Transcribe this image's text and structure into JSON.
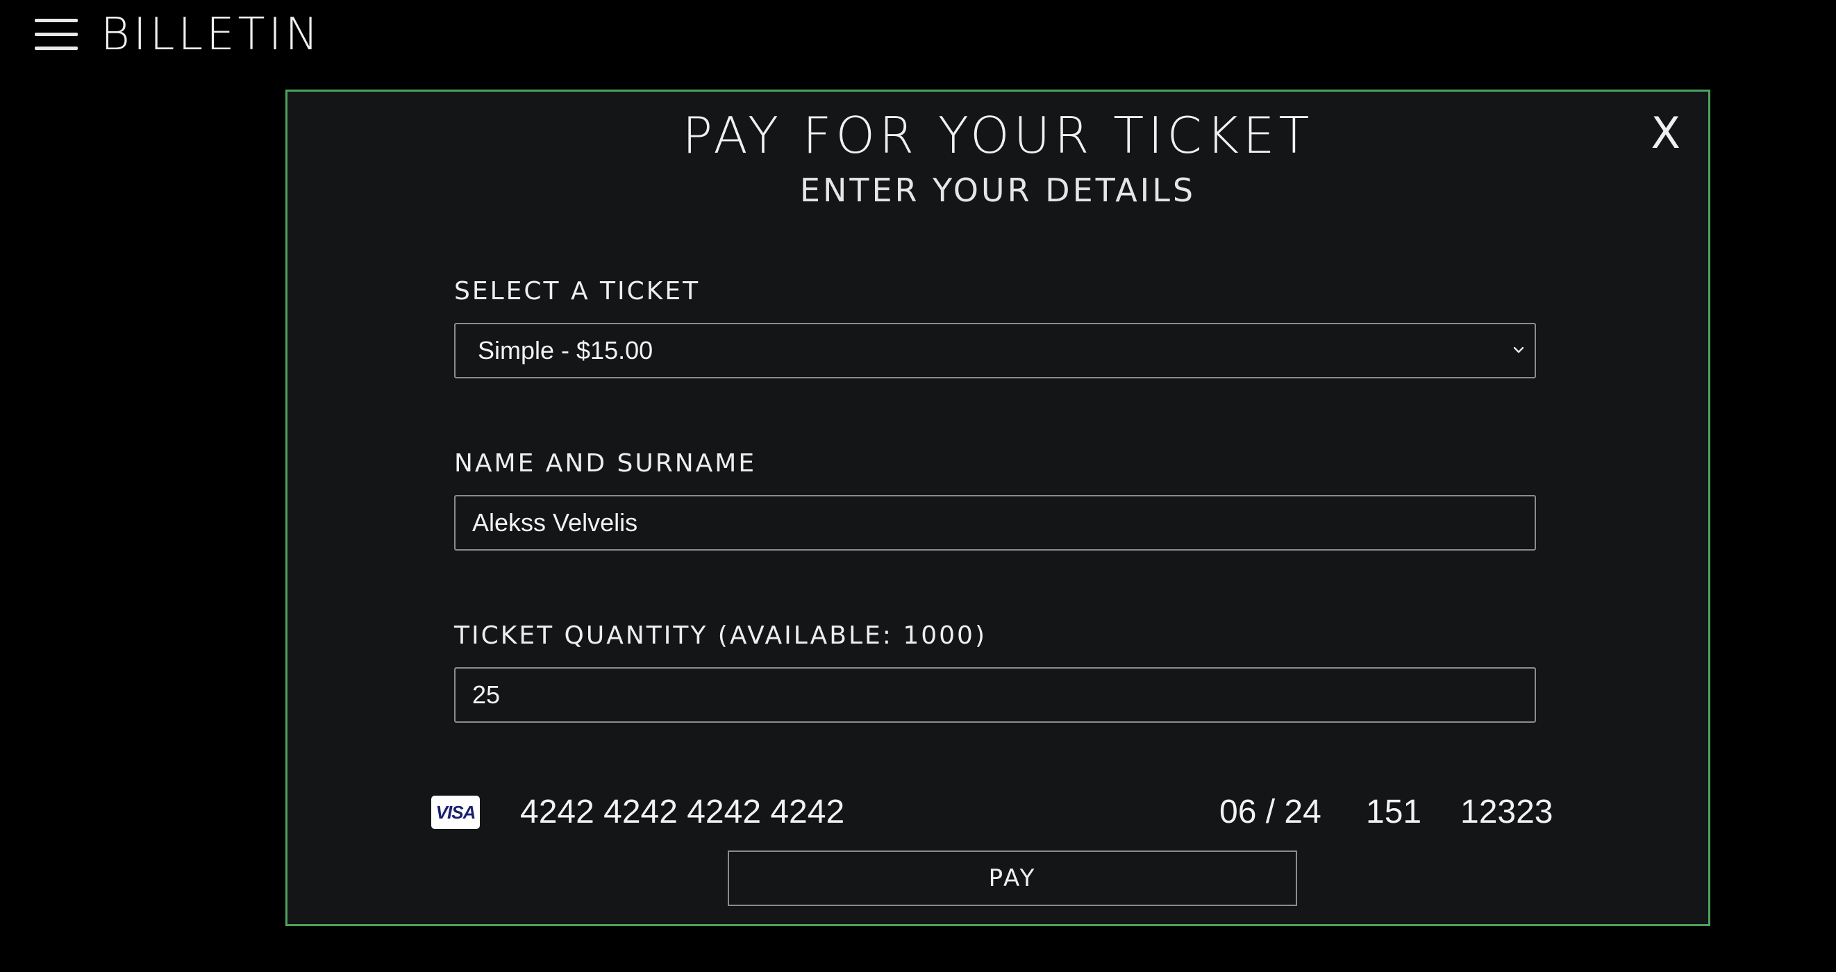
{
  "header": {
    "brand": "BILLETIN",
    "menu_icon": "hamburger-menu-icon"
  },
  "modal": {
    "title": "PAY FOR YOUR TICKET",
    "subtitle": "ENTER YOUR DETAILS",
    "close_label": "X",
    "border_color": "#4ca45c",
    "ticket_select": {
      "label": "SELECT A TICKET",
      "value": "Simple - $15.00"
    },
    "name_field": {
      "label": "NAME AND SURNAME",
      "value": "Alekss Velvelis"
    },
    "quantity_field": {
      "label": "TICKET QUANTITY (AVAILABLE: 1000)",
      "value": "25"
    },
    "card": {
      "brand": "VISA",
      "number": "4242 4242 4242 4242",
      "expiry": "06 / 24",
      "cvc": "151",
      "zip": "12323"
    },
    "pay_label": "PAY"
  }
}
